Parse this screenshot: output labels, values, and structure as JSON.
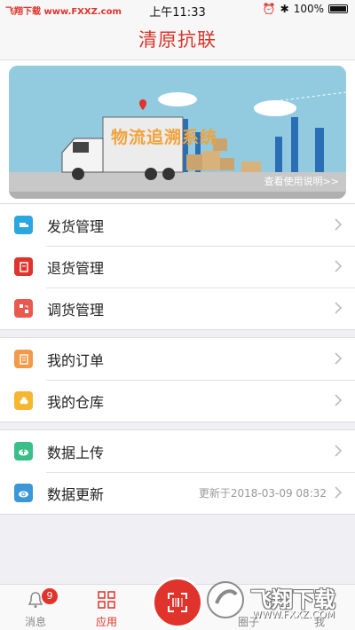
{
  "status_bar": {
    "left_text": "飞翔下载 www.FXXZ.com",
    "time": "上午11:33",
    "battery": "100%"
  },
  "header": {
    "title": "清原抗联"
  },
  "banner": {
    "title": "物流追溯系统",
    "caption": "查看使用说明>>"
  },
  "groups": [
    {
      "items": [
        {
          "label": "发货管理",
          "icon": "truck-icon",
          "color": "#2ba6df"
        },
        {
          "label": "退货管理",
          "icon": "return-icon",
          "color": "#e0332b"
        },
        {
          "label": "调货管理",
          "icon": "transfer-icon",
          "color": "#e85a4f"
        }
      ]
    },
    {
      "items": [
        {
          "label": "我的订单",
          "icon": "order-icon",
          "color": "#f2994a"
        },
        {
          "label": "我的仓库",
          "icon": "warehouse-icon",
          "color": "#f5b731"
        }
      ]
    },
    {
      "items": [
        {
          "label": "数据上传",
          "icon": "cloud-upload-icon",
          "color": "#3bbf8a"
        },
        {
          "label": "数据更新",
          "icon": "cloud-refresh-icon",
          "color": "#3a98d8",
          "sub": "更新于2018-03-09 08:32"
        }
      ]
    }
  ],
  "tabbar": {
    "messages": {
      "label": "消息",
      "badge": "9"
    },
    "apps": {
      "label": "应用"
    },
    "circle": {
      "label": "圈子"
    },
    "me": {
      "label": "我"
    }
  },
  "watermark": {
    "text": "飞翔下载",
    "url": "WWW.FXXZ.COM"
  },
  "colors": {
    "accent": "#e0332b",
    "title": "#d9352a"
  }
}
